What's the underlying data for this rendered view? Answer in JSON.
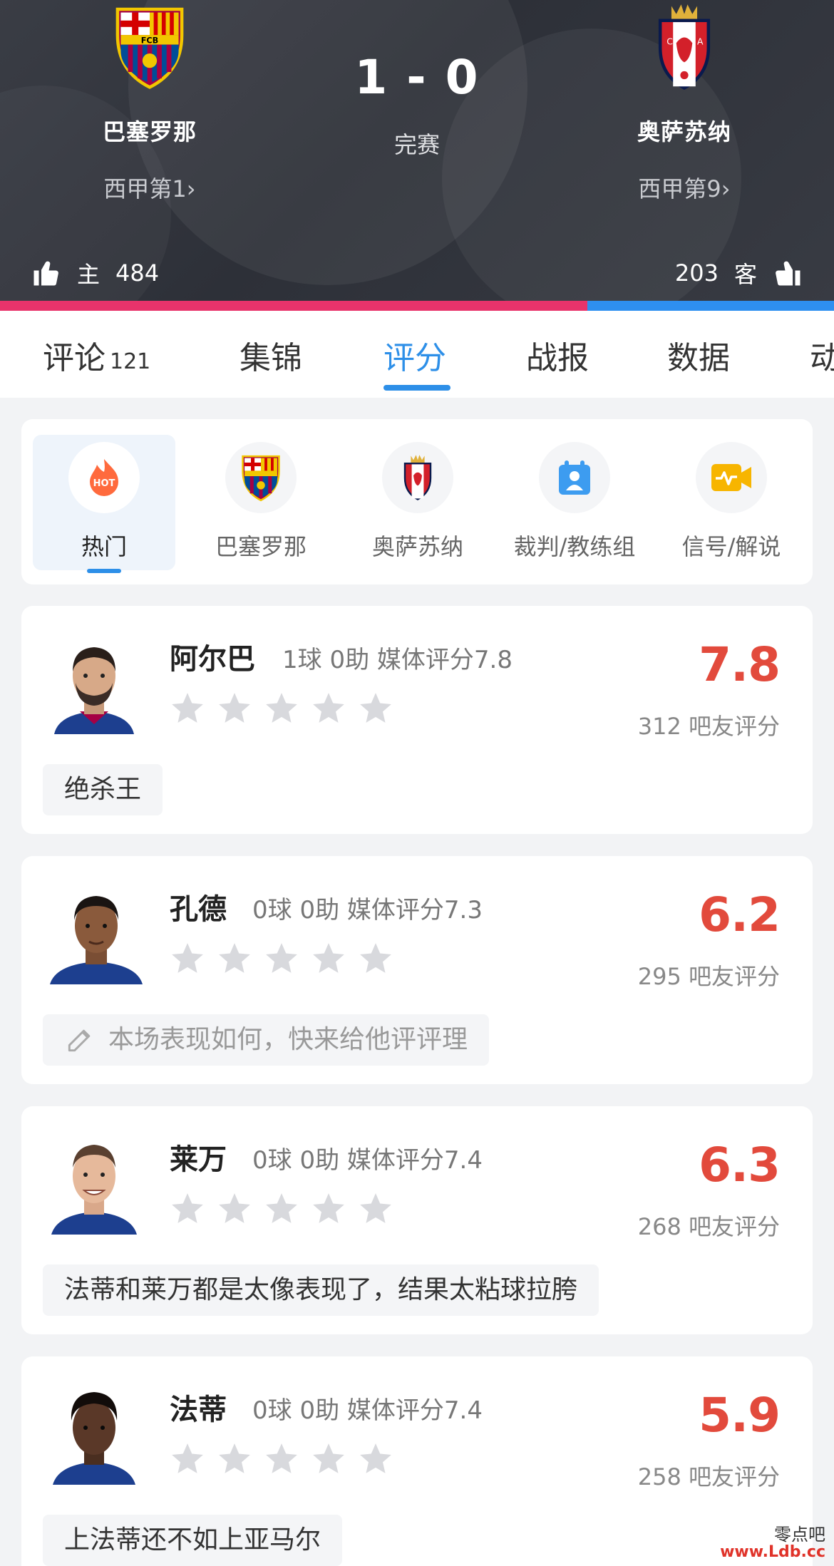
{
  "match": {
    "home": {
      "name": "巴塞罗那",
      "rank": "西甲第1",
      "likes": "484",
      "side_label": "主"
    },
    "away": {
      "name": "奥萨苏纳",
      "rank": "西甲第9",
      "likes": "203",
      "side_label": "客"
    },
    "score": "1 - 0",
    "status": "完赛",
    "support_ratio": {
      "home": 0.704,
      "away": 0.296
    },
    "colors": {
      "home_bar": "#e8336b",
      "away_bar": "#2e8ff0"
    }
  },
  "tabs": [
    {
      "label": "评论",
      "count": "121"
    },
    {
      "label": "集锦"
    },
    {
      "label": "评分",
      "active": true
    },
    {
      "label": "战报"
    },
    {
      "label": "数据"
    },
    {
      "label": "动"
    }
  ],
  "filters": [
    {
      "label": "热门",
      "icon": "hot-icon",
      "active": true
    },
    {
      "label": "巴塞罗那",
      "icon": "barcelona-crest-icon"
    },
    {
      "label": "奥萨苏纳",
      "icon": "osasuna-crest-icon"
    },
    {
      "label": "裁判/教练组",
      "icon": "referee-icon"
    },
    {
      "label": "信号/解说",
      "icon": "broadcast-icon"
    }
  ],
  "players": [
    {
      "name": "阿尔巴",
      "stats": "1球 0助  媒体评分7.8",
      "rating": "7.8",
      "votes": "312 吧友评分",
      "comment": "绝杀王",
      "comment_is_prompt": false
    },
    {
      "name": "孔德",
      "stats": "0球 0助  媒体评分7.3",
      "rating": "6.2",
      "votes": "295 吧友评分",
      "comment": "本场表现如何，快来给他评评理",
      "comment_is_prompt": true
    },
    {
      "name": "莱万",
      "stats": "0球 0助  媒体评分7.4",
      "rating": "6.3",
      "votes": "268 吧友评分",
      "comment": "法蒂和莱万都是太像表现了，结果太粘球拉胯",
      "comment_is_prompt": false
    },
    {
      "name": "法蒂",
      "stats": "0球 0助  媒体评分7.4",
      "rating": "5.9",
      "votes": "258 吧友评分",
      "comment": "上法蒂还不如上亚马尔",
      "comment_is_prompt": false
    }
  ],
  "hot_badge": "HOT",
  "watermark": {
    "line1": "零点吧",
    "line2": "www.Ldb.cc"
  }
}
